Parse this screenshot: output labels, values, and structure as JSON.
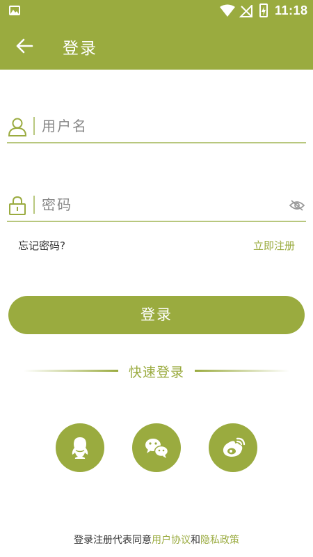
{
  "status_bar": {
    "time": "11:18",
    "icons": [
      "image-icon",
      "wifi-icon",
      "no-signal-icon",
      "battery-charging-icon"
    ]
  },
  "app_bar": {
    "back_icon": "arrow-left-icon",
    "title": "登录"
  },
  "username": {
    "icon": "user-icon",
    "placeholder": "用户名",
    "value": ""
  },
  "password": {
    "icon": "lock-icon",
    "placeholder": "密码",
    "value": "",
    "visibility_icon": "eye-off-icon"
  },
  "links": {
    "forgot": "忘记密码?",
    "register": "立即注册"
  },
  "login_button": "登录",
  "quick_login": {
    "label": "快速登录",
    "providers": [
      {
        "name": "QQ",
        "icon": "qq-icon"
      },
      {
        "name": "WeChat",
        "icon": "wechat-icon"
      },
      {
        "name": "Weibo",
        "icon": "weibo-icon"
      }
    ]
  },
  "agreement": {
    "prefix": "登录注册代表同意",
    "user_agreement": "用户协议",
    "and": "和",
    "privacy_policy": "隐私政策"
  },
  "colors": {
    "accent": "#9aab3f",
    "underline": "#b8c77e"
  }
}
